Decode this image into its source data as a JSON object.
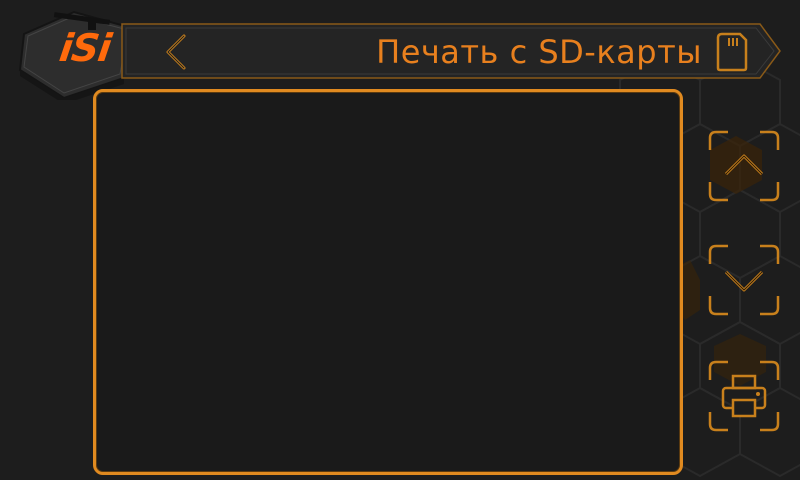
{
  "app": {
    "logo_text": "iSi"
  },
  "header": {
    "title": "Печать с SD-карты",
    "back_icon": "chevron-left-icon",
    "sd_icon": "sd-card-icon"
  },
  "file_list": {
    "items": []
  },
  "side_buttons": [
    {
      "name": "scroll-up-button",
      "icon": "chevron-up-icon"
    },
    {
      "name": "scroll-down-button",
      "icon": "chevron-down-icon"
    },
    {
      "name": "print-button",
      "icon": "printer-icon"
    }
  ],
  "colors": {
    "accent": "#e08a20",
    "title": "#e8801e",
    "logo": "#ff6a0c",
    "background": "#1d1d1d"
  }
}
